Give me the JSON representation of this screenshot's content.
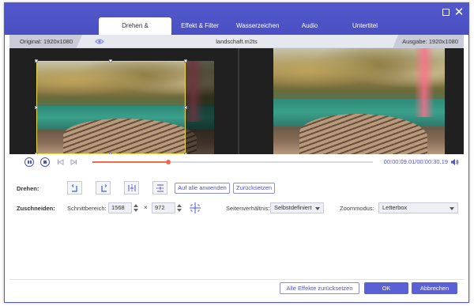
{
  "window": {
    "maximize_icon": "maximize-icon",
    "close_icon": "close-icon",
    "accent_color": "#4e54c8"
  },
  "tabs": [
    {
      "label": "Drehen & Zuschneiden",
      "active": true
    },
    {
      "label": "Effekt & Filter",
      "active": false
    },
    {
      "label": "Wasserzeichen",
      "active": false
    },
    {
      "label": "Audio",
      "active": false
    },
    {
      "label": "Untertitel",
      "active": false
    }
  ],
  "infobar": {
    "original": "Original: 1920x1080",
    "filename": "landschaft.m2ts",
    "output": "Ausgabe: 1920x1080",
    "eye_icon": "eye-icon"
  },
  "player": {
    "progress": 0.27,
    "time": "00:00:09.01/00:00:30.19",
    "progress_color": "#f06a4a"
  },
  "rotate": {
    "label": "Drehen:",
    "apply_all": "Auf alle anwenden",
    "reset": "Zurücksetzen"
  },
  "crop": {
    "label": "Zuschneiden:",
    "area_label": "Schnittbereich:",
    "width": "1568",
    "times": "×",
    "height": "972",
    "aspect_label": "Seitenverhältnis:",
    "aspect_value": "Selbstdefiniert",
    "zoom_label": "Zoommodus:",
    "zoom_value": "Letterbox"
  },
  "footer": {
    "reset_all": "Alle Effekte zurücksetzen",
    "ok": "OK",
    "cancel": "Abbrechen"
  }
}
